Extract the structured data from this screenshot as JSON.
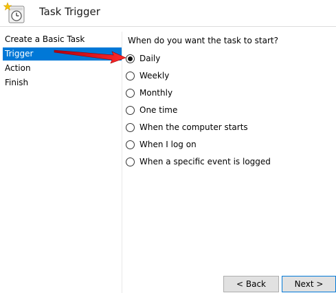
{
  "header": {
    "title": "Task Trigger"
  },
  "nav": {
    "items": [
      {
        "label": "Create a Basic Task"
      },
      {
        "label": "Trigger"
      },
      {
        "label": "Action"
      },
      {
        "label": "Finish"
      }
    ],
    "active_index": 1
  },
  "main": {
    "question": "When do you want the task to start?",
    "options": [
      {
        "label": "Daily",
        "selected": true
      },
      {
        "label": "Weekly",
        "selected": false
      },
      {
        "label": "Monthly",
        "selected": false
      },
      {
        "label": "One time",
        "selected": false
      },
      {
        "label": "When the computer starts",
        "selected": false
      },
      {
        "label": "When I log on",
        "selected": false
      },
      {
        "label": "When a specific event is logged",
        "selected": false
      }
    ]
  },
  "buttons": {
    "back": "< Back",
    "next": "Next >"
  },
  "colors": {
    "selection": "#0078d7",
    "annotation_arrow": "#e8141c"
  }
}
